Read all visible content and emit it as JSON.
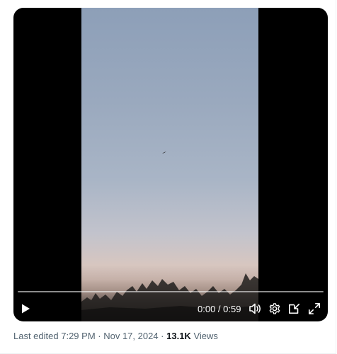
{
  "player": {
    "time": {
      "current": "0:00",
      "separator": " / ",
      "duration": "0:59"
    },
    "progress": 0.0,
    "icons": {
      "play": "play-icon",
      "volume": "volume-icon",
      "settings": "gear-icon",
      "pip": "picture-in-picture-icon",
      "fullscreen": "fullscreen-icon"
    }
  },
  "post_meta": {
    "edited_label": "Last edited",
    "time": "7:29 PM",
    "dot": " · ",
    "date": "Nov 17, 2024",
    "views_count": "13.1K",
    "views_label": "Views"
  },
  "colors": {
    "meta_text": "#536471",
    "emphasis_text": "#0f1419",
    "player_bg": "#000000"
  }
}
